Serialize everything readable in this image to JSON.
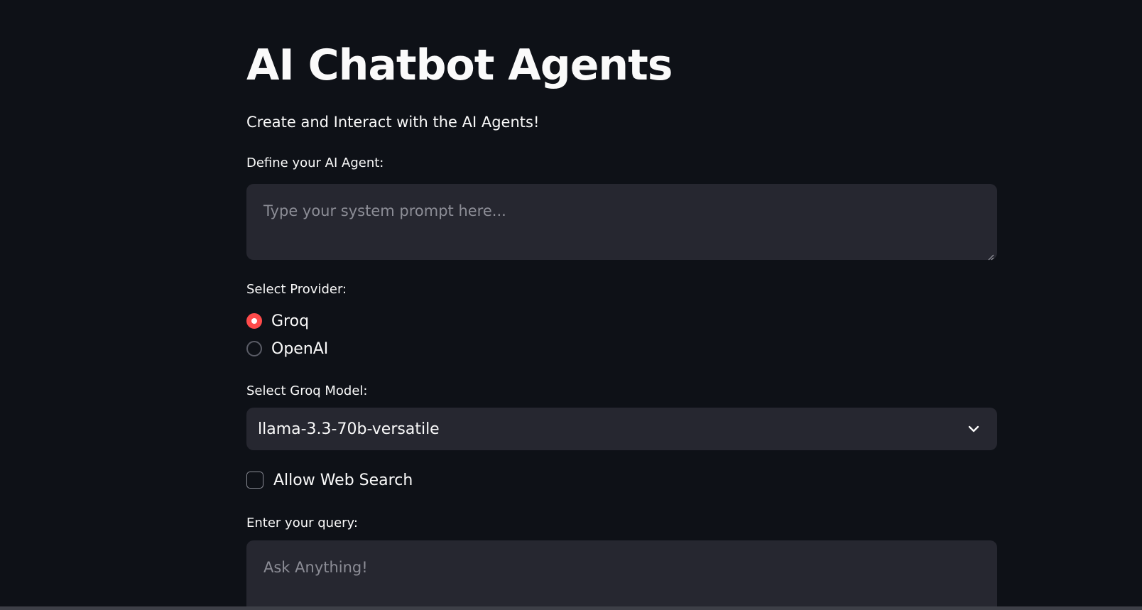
{
  "header": {
    "title": "AI Chatbot Agents",
    "subtitle": "Create and Interact with the AI Agents!"
  },
  "system_prompt": {
    "label": "Define your AI Agent:",
    "placeholder": "Type your system prompt here...",
    "value": ""
  },
  "provider": {
    "label": "Select Provider:",
    "options": [
      {
        "label": "Groq",
        "selected": true
      },
      {
        "label": "OpenAI",
        "selected": false
      }
    ]
  },
  "model": {
    "label": "Select Groq Model:",
    "selected": "llama-3.3-70b-versatile",
    "icon": "chevron-down-icon"
  },
  "web_search": {
    "label": "Allow Web Search",
    "checked": false
  },
  "query": {
    "label": "Enter your query:",
    "placeholder": "Ask Anything!",
    "value": ""
  },
  "colors": {
    "background": "#0e1117",
    "input_bg": "#262730",
    "accent": "#ff4b4b",
    "text": "#fafafa",
    "placeholder": "#8c8d96"
  }
}
